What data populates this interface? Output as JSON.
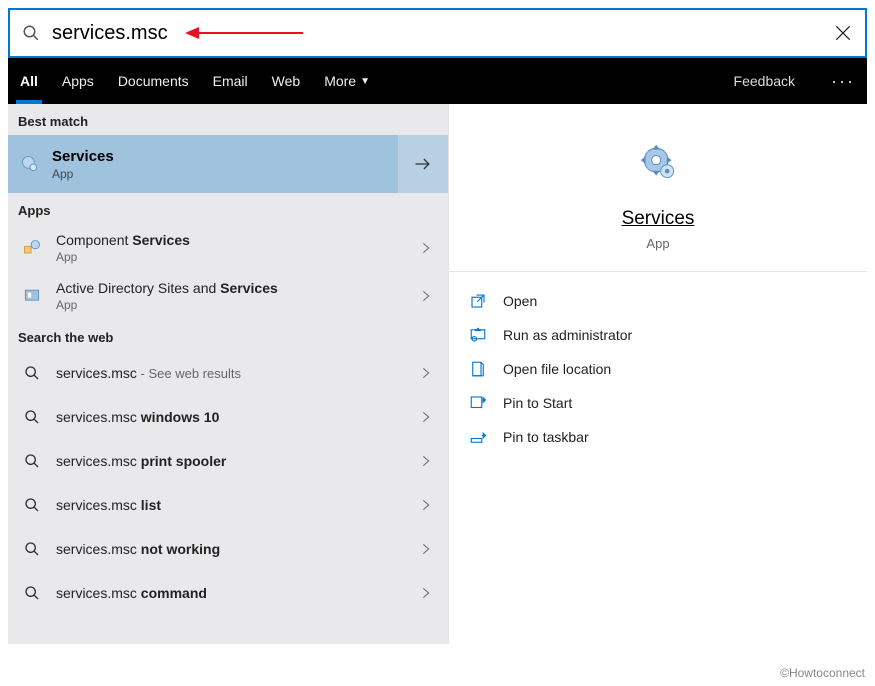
{
  "search": {
    "value": "services.msc"
  },
  "tabs": {
    "all": "All",
    "apps": "Apps",
    "documents": "Documents",
    "email": "Email",
    "web": "Web",
    "more": "More",
    "feedback": "Feedback"
  },
  "sections": {
    "best_match": "Best match",
    "apps": "Apps",
    "search_web": "Search the web"
  },
  "best_match": {
    "title": "Services",
    "subtitle": "App"
  },
  "apps": [
    {
      "title_prefix": "Component ",
      "title_bold": "Services",
      "subtitle": "App"
    },
    {
      "title_prefix": "Active Directory Sites and ",
      "title_bold": "Services",
      "subtitle": "App"
    }
  ],
  "web": [
    {
      "query": "services.msc",
      "bold_suffix": "",
      "suffix": " - See web results"
    },
    {
      "query": "services.msc ",
      "bold_suffix": "windows 10",
      "suffix": ""
    },
    {
      "query": "services.msc ",
      "bold_suffix": "print spooler",
      "suffix": ""
    },
    {
      "query": "services.msc ",
      "bold_suffix": "list",
      "suffix": ""
    },
    {
      "query": "services.msc ",
      "bold_suffix": "not working",
      "suffix": ""
    },
    {
      "query": "services.msc ",
      "bold_suffix": "command",
      "suffix": ""
    }
  ],
  "preview": {
    "title": "Services",
    "type": "App"
  },
  "actions": {
    "open": "Open",
    "run_admin": "Run as administrator",
    "open_location": "Open file location",
    "pin_start": "Pin to Start",
    "pin_taskbar": "Pin to taskbar"
  },
  "watermark": "©Howtoconnect"
}
